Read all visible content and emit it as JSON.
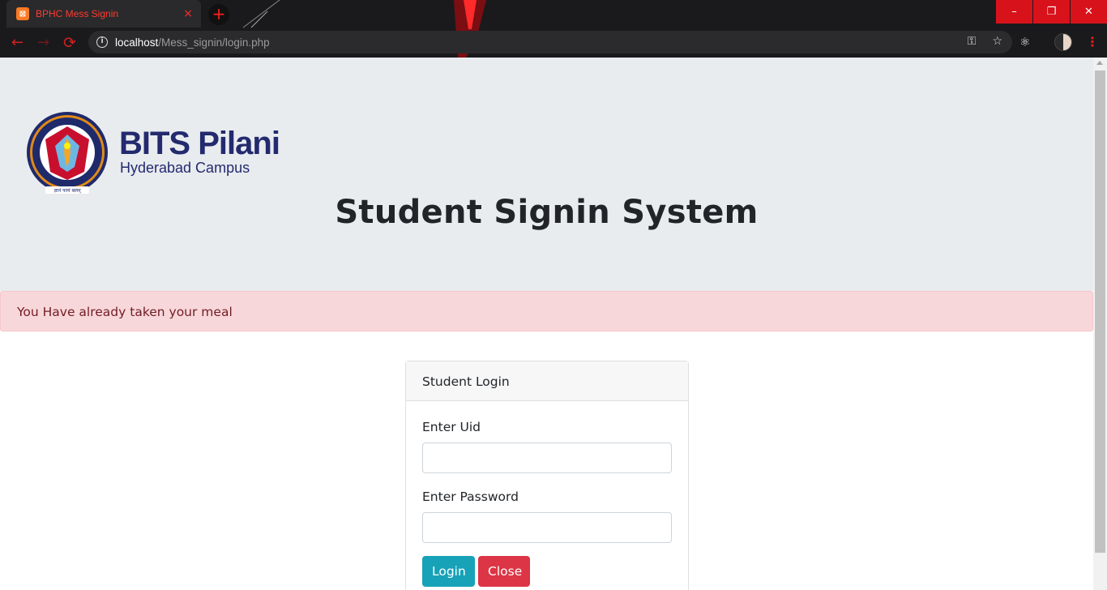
{
  "browser": {
    "tab_title": "BPHC Mess Signin",
    "tab_favicon_glyph": "⊠",
    "close_tab_glyph": "×",
    "new_tab_glyph": "+",
    "url_host": "localhost",
    "url_path": "/Mess_signin/login.php",
    "window_buttons": [
      "–",
      "❐",
      "✕"
    ],
    "nav": {
      "back": "←",
      "forward": "→",
      "reload": "⟳"
    },
    "omnibox_icons": [
      "key-icon",
      "star-icon"
    ],
    "accent_color": "#d8121b"
  },
  "header": {
    "logo": {
      "wordmark": "BITS Pilani",
      "subtitle": "Hyderabad Campus",
      "seal_text": "BIRLA INSTITUTE OF TECHNOLOGY & SCIENCE, PILANI",
      "motto": "ज्ञानं परमं बलम्"
    },
    "title": "Student Signin System"
  },
  "alert": {
    "message": "You Have already taken your meal",
    "color": "#f8d7da"
  },
  "login_card": {
    "header": "Student Login",
    "uid_label": "Enter Uid",
    "uid_value": "",
    "password_label": "Enter Password",
    "password_value": "",
    "login_button": "Login",
    "close_button": "Close",
    "login_color": "#17a2b8",
    "close_color": "#dc3545"
  }
}
